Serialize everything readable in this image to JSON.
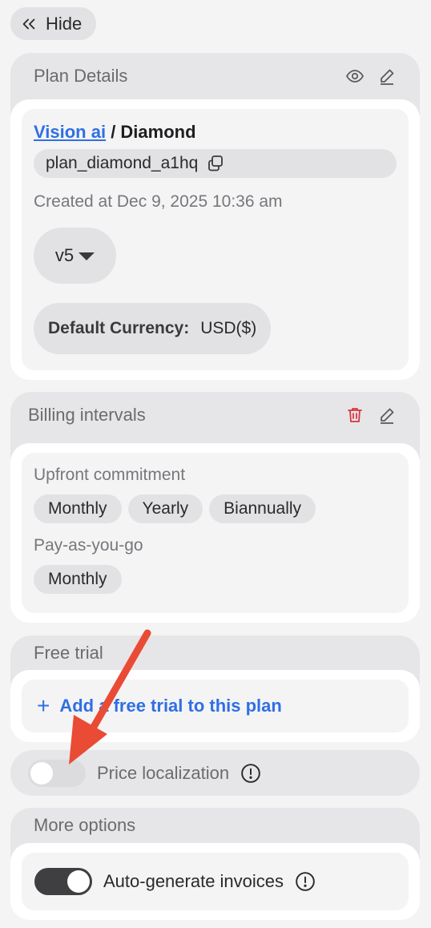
{
  "hide_button": {
    "label": "Hide",
    "icon": "double-chevron-left-icon"
  },
  "plan_details": {
    "title": "Plan Details",
    "product_link": "Vision ai",
    "separator": " / ",
    "plan_name": "Diamond",
    "plan_id": "plan_diamond_a1hq",
    "created": "Created at Dec 9, 2025 10:36 am",
    "version": "v5",
    "currency_label": "Default Currency:",
    "currency_value": "USD($)"
  },
  "billing_intervals": {
    "title": "Billing intervals",
    "upfront_label": "Upfront commitment",
    "upfront_options": [
      "Monthly",
      "Yearly",
      "Biannually"
    ],
    "payg_label": "Pay-as-you-go",
    "payg_options": [
      "Monthly"
    ]
  },
  "free_trial": {
    "title": "Free trial",
    "add_label": "Add a free trial to this plan",
    "plus": "+"
  },
  "price_localization": {
    "label": "Price localization",
    "enabled": false
  },
  "more_options": {
    "title": "More options",
    "auto_invoices_label": "Auto-generate invoices",
    "auto_invoices_enabled": true
  },
  "colors": {
    "link": "#2f6fe3",
    "delete": "#d9363e",
    "annotation_arrow": "#ea4b35"
  }
}
